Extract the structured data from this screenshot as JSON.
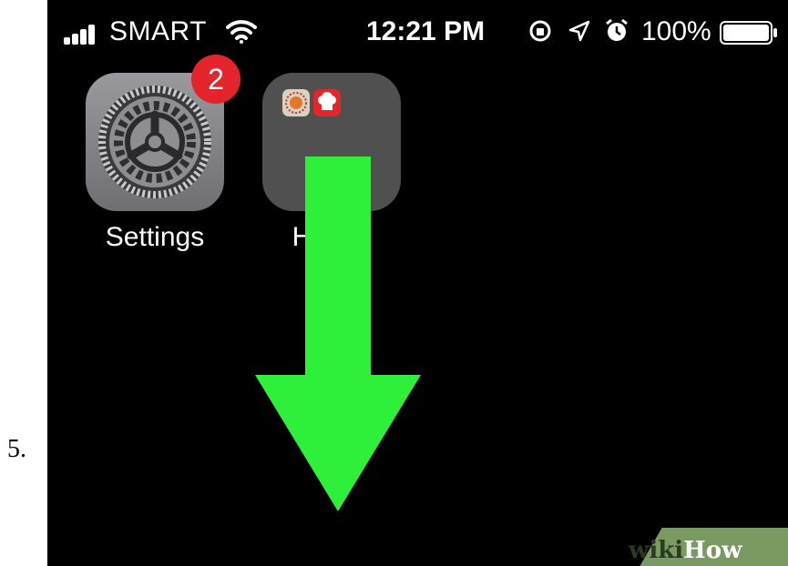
{
  "step": {
    "number": "5."
  },
  "status_bar": {
    "carrier": "SMART",
    "time": "12:21 PM",
    "battery_percent": "100%",
    "icons": [
      "signal-icon",
      "wifi-icon",
      "orientation-lock-icon",
      "location-icon",
      "alarm-icon",
      "battery-icon"
    ]
  },
  "apps": [
    {
      "label": "Settings",
      "badge": "2",
      "icon": "settings-gear-icon"
    },
    {
      "label": "Health",
      "icon": "folder-icon"
    }
  ],
  "gesture": {
    "direction": "down",
    "icon": "swipe-down-arrow-icon",
    "color": "#2ef03a"
  },
  "watermark": {
    "prefix": "wiki",
    "suffix": "How"
  },
  "colors": {
    "background": "#000000",
    "badge": "#e3242b",
    "arrow": "#2ef03a"
  }
}
